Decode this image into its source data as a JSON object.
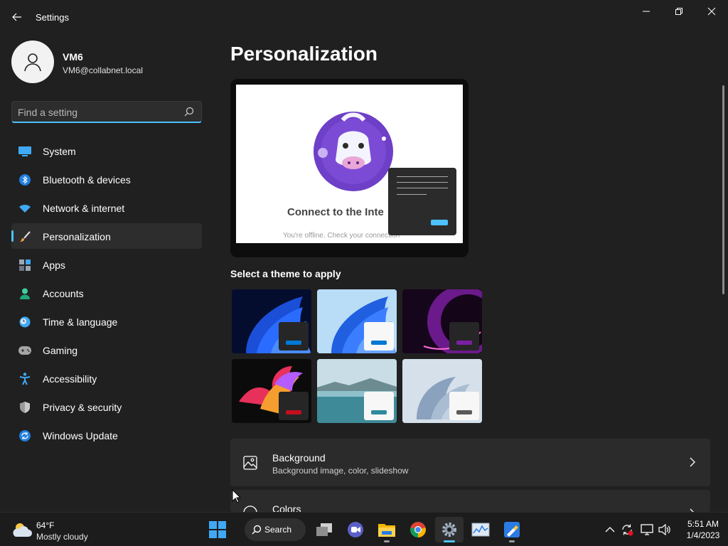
{
  "window": {
    "title": "Settings"
  },
  "user": {
    "name": "VM6",
    "email": "VM6@collabnet.local"
  },
  "search": {
    "placeholder": "Find a setting",
    "value": ""
  },
  "sidebar": {
    "items": [
      {
        "label": "System",
        "icon": "monitor-icon"
      },
      {
        "label": "Bluetooth & devices",
        "icon": "bluetooth-icon"
      },
      {
        "label": "Network & internet",
        "icon": "wifi-icon"
      },
      {
        "label": "Personalization",
        "icon": "brush-icon",
        "selected": true
      },
      {
        "label": "Apps",
        "icon": "apps-icon"
      },
      {
        "label": "Accounts",
        "icon": "person-icon"
      },
      {
        "label": "Time & language",
        "icon": "clock-globe-icon"
      },
      {
        "label": "Gaming",
        "icon": "gamepad-icon"
      },
      {
        "label": "Accessibility",
        "icon": "accessibility-icon"
      },
      {
        "label": "Privacy & security",
        "icon": "shield-icon"
      },
      {
        "label": "Windows Update",
        "icon": "update-icon"
      }
    ]
  },
  "main": {
    "title": "Personalization",
    "preview": {
      "headline": "Connect to the Inte",
      "subtext": "You're offline. Check your connection"
    },
    "themes_heading": "Select a theme to apply",
    "themes": [
      {
        "name": "windows-dark-bloom",
        "accent": "#0078d4"
      },
      {
        "name": "windows-light-bloom",
        "accent": "#0078d4"
      },
      {
        "name": "glow",
        "accent": "#7b1fa2"
      },
      {
        "name": "captured-motion",
        "accent": "#c50f1f"
      },
      {
        "name": "sunrise-lake",
        "accent": "#2d8a9e"
      },
      {
        "name": "flow",
        "accent": "#5a5a5a"
      }
    ],
    "cards": [
      {
        "title": "Background",
        "subtitle": "Background image, color, slideshow",
        "icon": "image-icon"
      },
      {
        "title": "Colors",
        "subtitle": "",
        "icon": "palette-icon"
      }
    ]
  },
  "taskbar": {
    "weather": {
      "temp": "64°F",
      "condition": "Mostly cloudy"
    },
    "search_label": "Search",
    "clock": {
      "time": "5:51 AM",
      "date": "1/4/2023"
    }
  },
  "colors": {
    "accent": "#4cc2ff",
    "background": "#202020",
    "card": "#2b2b2b"
  }
}
